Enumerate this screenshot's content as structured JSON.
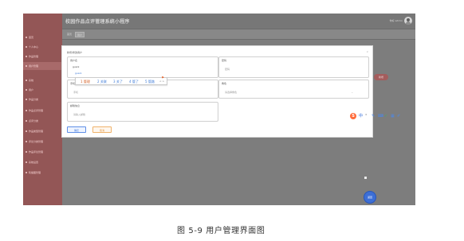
{
  "app": {
    "title": "校园作品点评管理系统小程序",
    "welcome": "你好 admin",
    "float_button": "返回"
  },
  "sidebar": {
    "items": [
      {
        "label": "首页"
      },
      {
        "label": "个人中心"
      },
      {
        "label": "作品管理"
      },
      {
        "label": "用户管理"
      },
      {
        "label": "系统"
      },
      {
        "label": "用户"
      },
      {
        "label": "作品分类"
      },
      {
        "label": "作品点评管理"
      },
      {
        "label": "点评分类"
      },
      {
        "label": "作品类型管理"
      },
      {
        "label": "评论分类管理"
      },
      {
        "label": "作品评论管理"
      },
      {
        "label": "系统设置"
      },
      {
        "label": "轮播图管理"
      }
    ]
  },
  "breadcrumb": {
    "home": "首页",
    "current": "用户"
  },
  "actions": {
    "search": "查询",
    "add": "新增"
  },
  "modal": {
    "title": "新增/修改用户",
    "close": "×",
    "fields": {
      "username": {
        "label": "用户名",
        "value": "guanl"
      },
      "password": {
        "label": "密码",
        "placeholder": "密码"
      },
      "phone": {
        "label": "手机",
        "placeholder": "手机"
      },
      "role": {
        "label": "角色",
        "placeholder": "请选择角色"
      },
      "email": {
        "label": "邮箱信息",
        "placeholder": "请输入邮箱"
      }
    },
    "buttons": {
      "confirm": "确定",
      "cancel": "取消"
    }
  },
  "ime": {
    "code": "guanl",
    "candidates": [
      "1 管理",
      "2 关联",
      "3 关了",
      "4 管了",
      "5 管路"
    ],
    "pager": "< >",
    "mark": "⚑",
    "toolbar": {
      "logo": "S",
      "items": [
        "中",
        "°",
        "✎",
        "⌨",
        "✓",
        "▦",
        "✐"
      ]
    }
  },
  "caption": "图 5-9 用户管理界面图"
}
